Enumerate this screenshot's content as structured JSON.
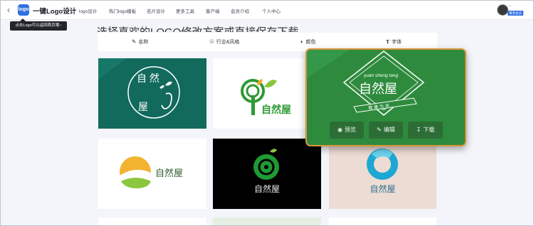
{
  "header": {
    "back_icon": "chevron-left-icon",
    "logo_text": "logo",
    "brand": "一键Logo设计",
    "nav": [
      "logo设计",
      "热门logo模板",
      "名片设计",
      "更多工具",
      "客户端",
      "会员介绍",
      "个人中心"
    ],
    "user_dots": "··",
    "vip_label": "尊贵会员",
    "brand_color": "#2f6fe0"
  },
  "tooltip": "点击Logo可以返回首页哦~",
  "page_title": "选择喜欢的LOGO修改方案或直接保存下载",
  "filters": [
    {
      "label": "名称",
      "icon": "pen-icon"
    },
    {
      "label": "行业&风格",
      "icon": "target-icon"
    },
    {
      "label": "颜色",
      "icon": "palette-icon"
    },
    {
      "label": "字体",
      "icon": "text-icon"
    }
  ],
  "cards": [
    {
      "name": "自然屋",
      "bg": "#116a5c"
    },
    {
      "name": "自然屋",
      "bg": "#ffffff"
    },
    {
      "name": "自然屋",
      "sub": "健康为本",
      "top": "yuan sheng tang",
      "bg": "#2e8b3d"
    },
    {
      "name": "自然屋",
      "bg": "#ffffff"
    },
    {
      "name": "自然屋",
      "bg": "#000000"
    },
    {
      "name": "自然屋",
      "bg": "#ecdcd3"
    }
  ],
  "actions": {
    "preview": "预览",
    "edit": "编辑",
    "download": "下载"
  }
}
